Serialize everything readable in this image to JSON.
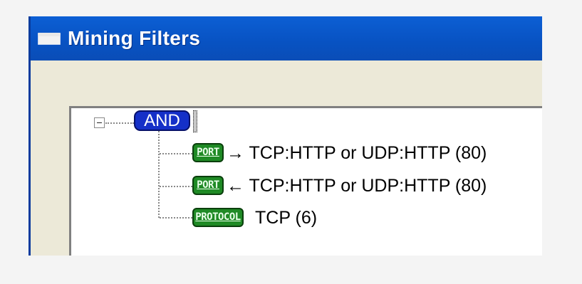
{
  "window": {
    "title": "Mining Filters"
  },
  "tree": {
    "root": {
      "label": "AND",
      "expanded": true
    },
    "children": [
      {
        "badge": "PORT",
        "text": "→ TCP:HTTP or UDP:HTTP (80)"
      },
      {
        "badge": "PORT",
        "text": "← TCP:HTTP or UDP:HTTP (80)"
      },
      {
        "badge": "PROTOCOL",
        "text": "TCP (6)"
      }
    ]
  }
}
